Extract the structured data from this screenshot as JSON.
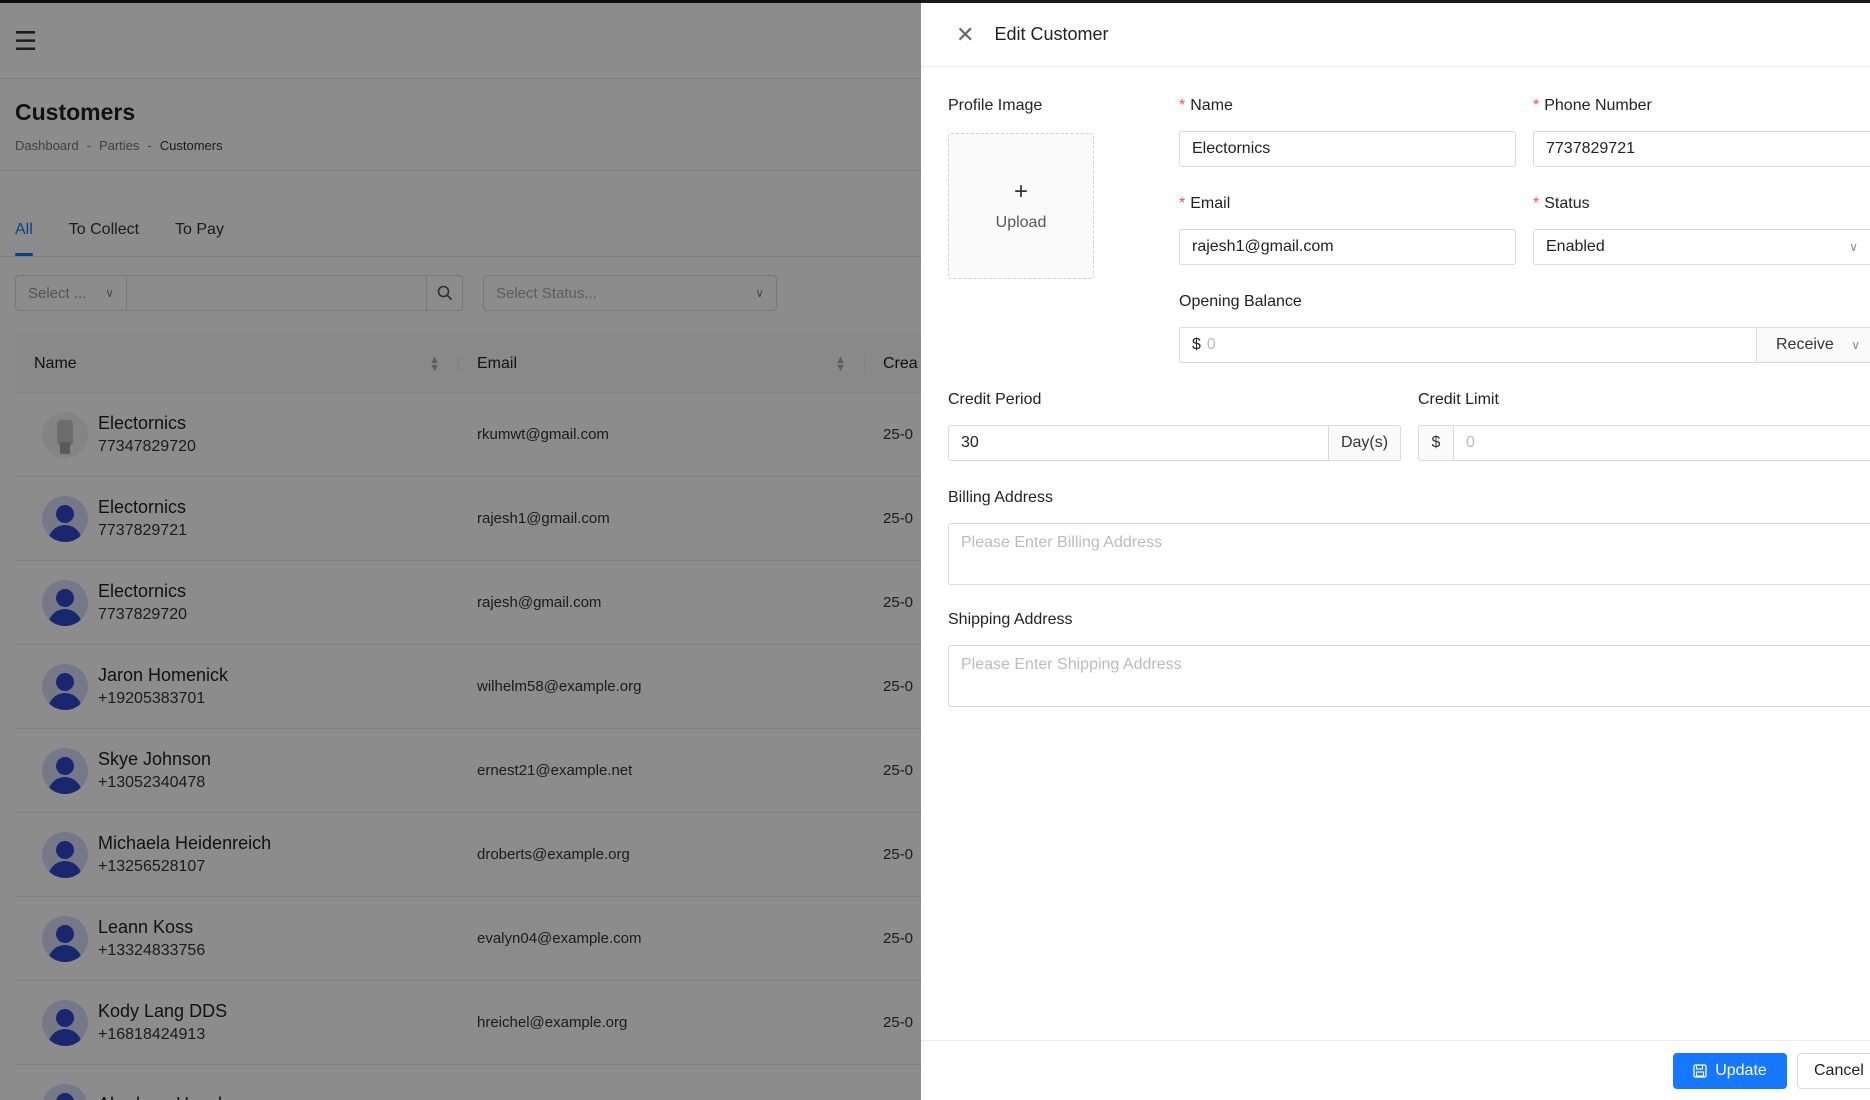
{
  "page": {
    "title": "Customers",
    "breadcrumb": [
      "Dashboard",
      "-",
      "Parties",
      "-",
      "Customers"
    ],
    "tabs": [
      "All",
      "To Collect",
      "To Pay"
    ],
    "filters": {
      "select_small_placeholder": "Select ...",
      "status_placeholder": "Select Status..."
    },
    "table": {
      "headers": {
        "name": "Name",
        "email": "Email",
        "created": "Crea"
      },
      "rows": [
        {
          "name": "Electornics",
          "phone": "77347829720",
          "email": "rkumwt@gmail.com",
          "created": "25-0"
        },
        {
          "name": "Electornics",
          "phone": "7737829721",
          "email": "rajesh1@gmail.com",
          "created": "25-0"
        },
        {
          "name": "Electornics",
          "phone": "7737829720",
          "email": "rajesh@gmail.com",
          "created": "25-0"
        },
        {
          "name": "Jaron Homenick",
          "phone": "+19205383701",
          "email": "wilhelm58@example.org",
          "created": "25-0"
        },
        {
          "name": "Skye Johnson",
          "phone": "+13052340478",
          "email": "ernest21@example.net",
          "created": "25-0"
        },
        {
          "name": "Michaela Heidenreich",
          "phone": "+13256528107",
          "email": "droberts@example.org",
          "created": "25-0"
        },
        {
          "name": "Leann Koss",
          "phone": "+13324833756",
          "email": "evalyn04@example.com",
          "created": "25-0"
        },
        {
          "name": "Kody Lang DDS",
          "phone": "+16818424913",
          "email": "hreichel@example.org",
          "created": "25-0"
        },
        {
          "name": "Abraham Hauck",
          "phone": "",
          "email": "",
          "created": ""
        }
      ]
    }
  },
  "drawer": {
    "title": "Edit Customer",
    "labels": {
      "profile_image": "Profile Image",
      "name": "Name",
      "phone": "Phone Number",
      "email": "Email",
      "status": "Status",
      "opening_balance": "Opening Balance",
      "credit_period": "Credit Period",
      "credit_limit": "Credit Limit",
      "billing_address": "Billing Address",
      "shipping_address": "Shipping Address",
      "required_mark": "*"
    },
    "upload_label": "Upload",
    "upload_plus": "+",
    "values": {
      "name": "Electornics",
      "phone": "7737829721",
      "email": "rajesh1@gmail.com",
      "status": "Enabled",
      "opening_balance_prefix": "$",
      "opening_balance_placeholder": "0",
      "opening_balance_type": "Receive",
      "credit_period": "30",
      "credit_period_unit": "Day(s)",
      "credit_limit_prefix": "$",
      "credit_limit_placeholder": "0",
      "billing_placeholder": "Please Enter Billing Address",
      "shipping_placeholder": "Please Enter Shipping Address"
    },
    "buttons": {
      "update": "Update",
      "cancel": "Cancel"
    },
    "colors": {
      "primary": "#1677ff",
      "required": "#ff4d4f",
      "overlay": "rgba(0,0,0,0.45)"
    }
  }
}
